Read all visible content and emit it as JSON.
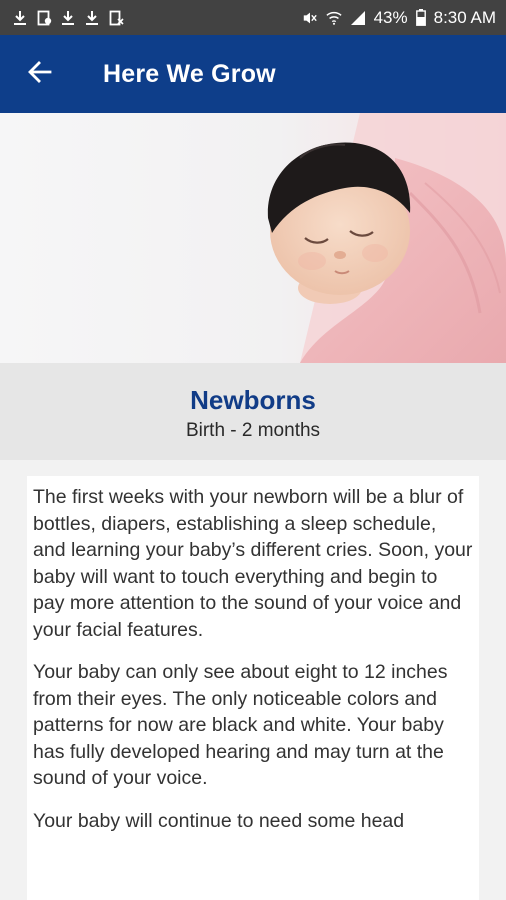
{
  "status_bar": {
    "battery": "43%",
    "time": "8:30 AM"
  },
  "app_bar": {
    "title": "Here We Grow"
  },
  "stage": {
    "title": "Newborns",
    "range": "Birth - 2 months"
  },
  "content": {
    "paragraphs": [
      "The first weeks with your newborn will be a blur of bottles, diapers, establishing a sleep schedule, and learning your baby’s different cries. Soon, your baby will want to touch everything and begin to pay more attention to the sound of your voice and your facial features.",
      "Your baby can only see about eight to 12 inches from their eyes. The only noticeable colors and patterns for now are black and white. Your baby has fully developed hearing and may turn at the sound of your voice.",
      "Your baby will continue to need some head"
    ]
  },
  "colors": {
    "app_bar": "#0e3e8a",
    "title_blue": "#113c87",
    "status_bar": "#424242"
  }
}
